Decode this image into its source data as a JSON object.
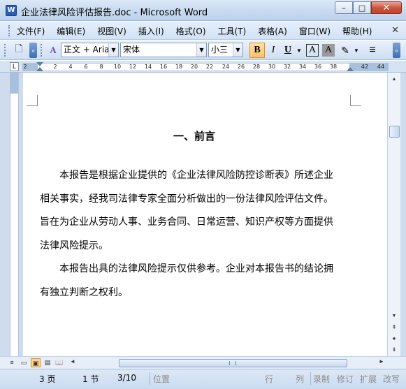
{
  "window": {
    "title": "企业法律风险评估报告.doc - Microsoft Word",
    "app_icon_letter": "W",
    "buttons": {
      "minimize": "–",
      "maximize": "□",
      "close": "✕"
    }
  },
  "menu": {
    "items": [
      "文件(F)",
      "编辑(E)",
      "视图(V)",
      "插入(I)",
      "格式(O)",
      "工具(T)",
      "表格(A)",
      "窗口(W)",
      "帮助(H)"
    ],
    "doc_close": "✕"
  },
  "toolbar": {
    "style_value": "正文 + Aria",
    "font_value": "宋体",
    "size_value": "小三",
    "bold_label": "B",
    "italic_label": "I",
    "underline_label": "U",
    "charborder_label": "A",
    "charshade_label": "A",
    "paragraph_icon": "≡",
    "highlight_icon": "✎",
    "new_doc_icon": "🗋"
  },
  "ruler": {
    "tab_selector": "L",
    "ticks": [
      "2",
      "2",
      "4",
      "6",
      "8",
      "10",
      "12",
      "14",
      "16",
      "18",
      "20",
      "22",
      "24",
      "26",
      "28",
      "30",
      "32",
      "34",
      "36",
      "38",
      "42",
      "44"
    ]
  },
  "document": {
    "heading": "一、前言",
    "lines": [
      {
        "text": "本报告是根据企业提供的《企业法律风险防控诊断表》所述企业",
        "indent": true
      },
      {
        "text": "相关事实，经我司法律专家全面分析做出的一份法律风险评估文件。",
        "indent": false
      },
      {
        "text": "旨在为企业从劳动人事、业务合同、日常运营、知识产权等方面提供",
        "indent": false
      },
      {
        "text": "法律风险提示。",
        "indent": false
      },
      {
        "text": "本报告出具的法律风险提示仅供参考。企业对本报告书的结论拥",
        "indent": true
      },
      {
        "text": "有独立判断之权利。",
        "indent": false
      }
    ]
  },
  "scrollbars": {
    "up": "▲",
    "down": "▼",
    "prev_page": "⇞",
    "select_browse": "●",
    "next_page": "⇟",
    "left": "◄",
    "right": "►"
  },
  "view_buttons": [
    "≡",
    "▭",
    "▣",
    "▤",
    "📖"
  ],
  "status": {
    "page": "3 页",
    "section": "1 节",
    "page_of": "3/10",
    "position": "位置",
    "line": "行",
    "column": "列",
    "record": "录制",
    "revise": "修订",
    "extend": "扩展",
    "overwrite": "改写"
  },
  "colors": {
    "titlebar": "#c7d9ef",
    "accent_orange": "#ffc26b",
    "close_red": "#c8513a"
  }
}
